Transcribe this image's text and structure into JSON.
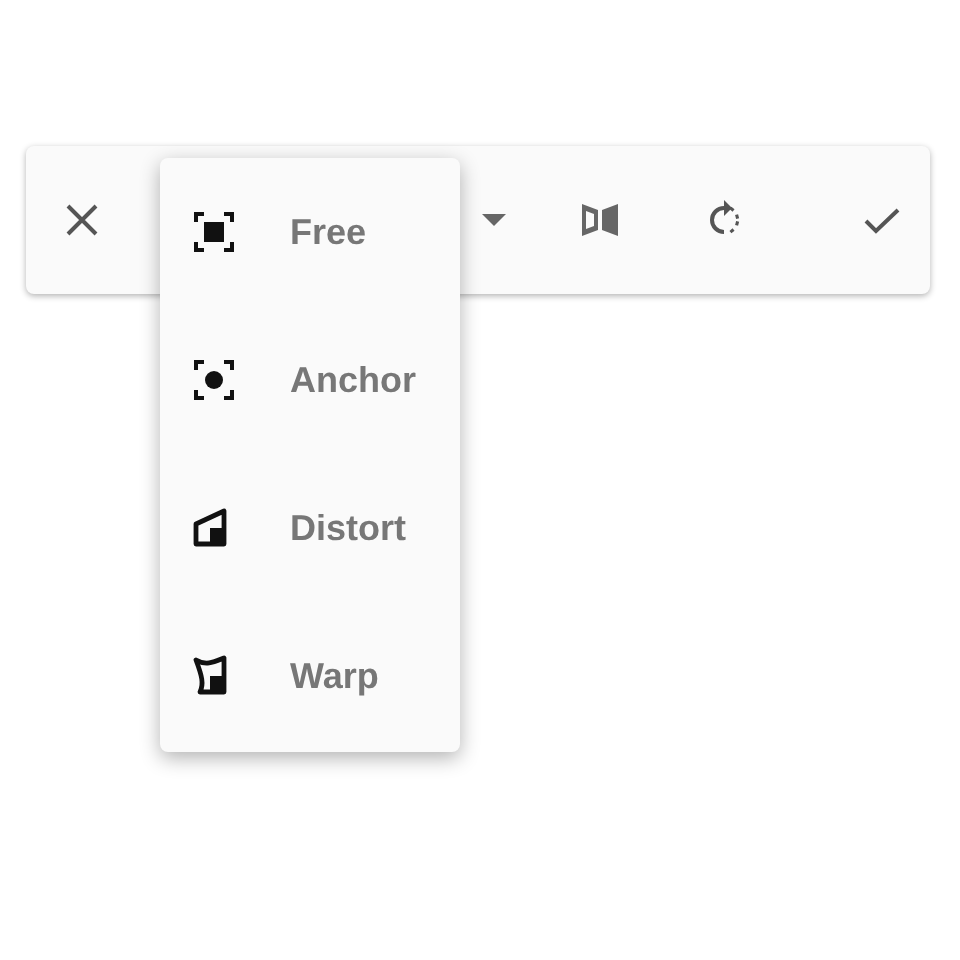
{
  "toolbar": {
    "buttons": [
      {
        "kind": "close"
      },
      {
        "kind": "caret"
      },
      {
        "kind": "flip"
      },
      {
        "kind": "rotate"
      },
      {
        "kind": "confirm"
      }
    ]
  },
  "menu": {
    "items": [
      {
        "label": "Free",
        "kind": "free"
      },
      {
        "label": "Anchor",
        "kind": "anchor"
      },
      {
        "label": "Distort",
        "kind": "distort"
      },
      {
        "label": "Warp",
        "kind": "warp"
      }
    ]
  }
}
